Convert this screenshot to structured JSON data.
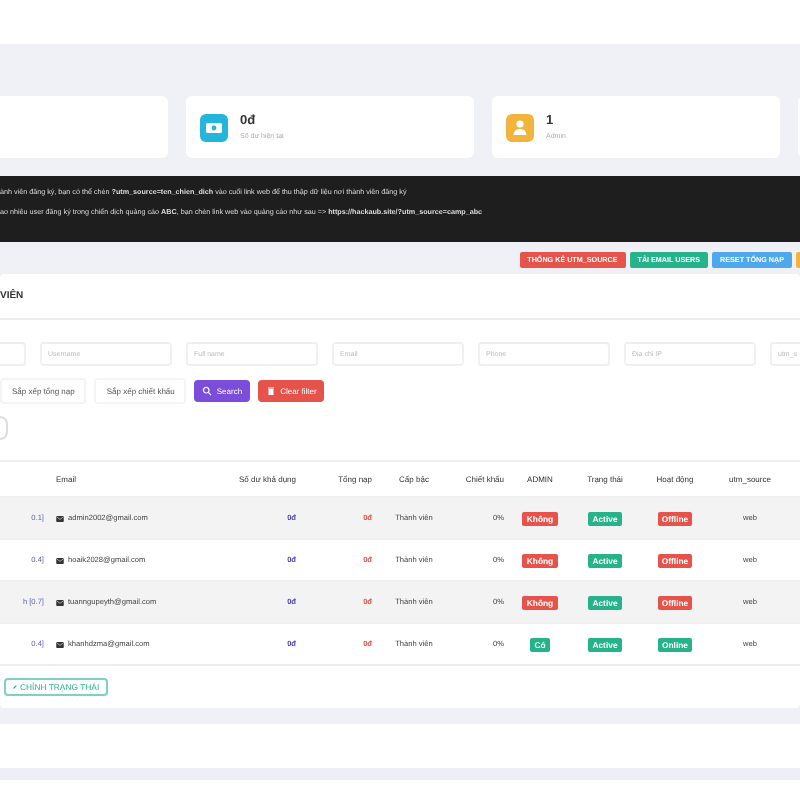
{
  "stats": [
    {
      "kind": "money",
      "value": "0đ",
      "label": "Số dư hiện tại"
    },
    {
      "kind": "user",
      "value": "1",
      "label": "Admin"
    }
  ],
  "notice": {
    "lines": [
      "ành viên đăng ký, bạn có thể chèn **?utm_source=ten_chien_dich** vào cuối link web để thu thập dữ liệu nơi thành viên đăng ký",
      "ao nhiêu user đăng ký trong chiến dịch quảng cáo **ABC**, bạn chèn link web vào quảng cáo như sau => **https://hackaub.site/?utm_source=camp_abc**"
    ]
  },
  "actions": [
    {
      "kind": "danger",
      "label": "THỐNG KÊ UTM_SOURCE"
    },
    {
      "kind": "success",
      "label": "TẢI EMAIL USERS"
    },
    {
      "kind": "info",
      "label": "RESET TỔNG NẠP"
    }
  ],
  "panel_title": "VIÊN",
  "filters": {
    "placeholders": [
      "Username",
      "Full name",
      "Email",
      "Phone",
      "Địa chỉ IP",
      "utm_s"
    ],
    "sorts": [
      "Sắp xếp tổng nạp",
      "Sắp xếp chiết khấu"
    ],
    "search": "Search",
    "clear": "Clear filter"
  },
  "table": {
    "columns": [
      "Email",
      "Số dư khả dụng",
      "Tổng nạp",
      "Cấp bậc",
      "Chiết khấu",
      "ADMIN",
      "Trạng thái",
      "Hoạt động",
      "utm_source"
    ],
    "rows": [
      {
        "column_1": "0.1]",
        "email": "admin2002@gmail.com",
        "balance": "0đ",
        "total": "0đ",
        "rank": "Thành viên",
        "discount": "0%",
        "admin": {
          "label": "Không",
          "on": false
        },
        "status": {
          "label": "Active",
          "on": true
        },
        "activity": {
          "label": "Offline",
          "on": false
        },
        "utm": "web"
      },
      {
        "column_1": "0.4]",
        "email": "hoaik2028@gmail.com",
        "balance": "0đ",
        "total": "0đ",
        "rank": "Thành viên",
        "discount": "0%",
        "admin": {
          "label": "Không",
          "on": false
        },
        "status": {
          "label": "Active",
          "on": true
        },
        "activity": {
          "label": "Offline",
          "on": false
        },
        "utm": "web"
      },
      {
        "column_1": "h [0.7]",
        "email": "tuanngupeyth@gmail.com",
        "balance": "0đ",
        "total": "0đ",
        "rank": "Thành viên",
        "discount": "0%",
        "admin": {
          "label": "Không",
          "on": false
        },
        "status": {
          "label": "Active",
          "on": true
        },
        "activity": {
          "label": "Offline",
          "on": false
        },
        "utm": "web"
      },
      {
        "column_1": "0.4]",
        "email": "khanhdzma@gmail.com",
        "balance": "0đ",
        "total": "0đ",
        "rank": "Thành viên",
        "discount": "0%",
        "admin": {
          "label": "Có",
          "on": true
        },
        "status": {
          "label": "Active",
          "on": true
        },
        "activity": {
          "label": "Online",
          "on": true
        },
        "utm": "web"
      }
    ]
  },
  "bulk_button": "CHỈNH TRẠNG THÁI"
}
